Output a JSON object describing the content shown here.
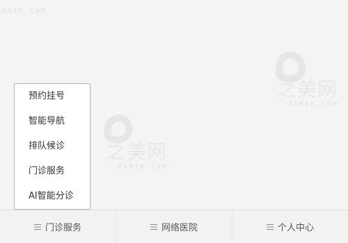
{
  "popup_menu": {
    "items": [
      {
        "label": "预约挂号"
      },
      {
        "label": "智能导航"
      },
      {
        "label": "排队候诊"
      },
      {
        "label": "门诊服务"
      },
      {
        "label": "AI智能分诊"
      }
    ]
  },
  "bottom_tabs": [
    {
      "label": "门诊服务",
      "icon": "menu-icon"
    },
    {
      "label": "网络医院",
      "icon": "menu-icon"
    },
    {
      "label": "个人中心",
      "icon": "menu-icon"
    }
  ],
  "watermark": {
    "text": "之美网",
    "subtext": "- ZANIH.COM -"
  },
  "colors": {
    "background": "#f4f4f4",
    "popup_bg": "#ffffff",
    "popup_border": "#b9b9b9",
    "tab_text": "#555555",
    "watermark": "#e5e5e5"
  }
}
